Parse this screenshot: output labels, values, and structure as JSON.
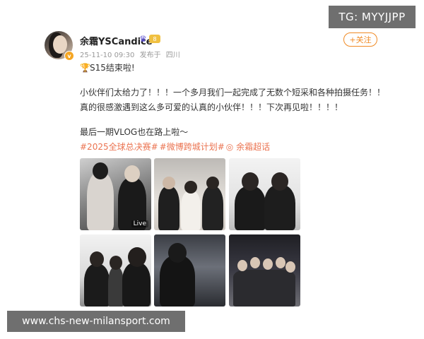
{
  "watermarks": {
    "tg": "TG: MYYJJPP",
    "site": "www.chs-new-milansport.com"
  },
  "post": {
    "author": {
      "name": "余霜YSCandice",
      "level_badge": "8"
    },
    "meta": {
      "timestamp": "25-11-10 09:30",
      "source": "发布于",
      "location": "四川"
    },
    "follow_label": "+关注",
    "lines": {
      "title": "S15结束啦!",
      "p1": "小伙伴们太给力了！！！一个多月我们一起完成了无数个短采和各种拍摄任务！！",
      "p2": "真的很感激遇到这么多可爱的认真的小伙伴！！！下次再见啦！！！！",
      "p3": "最后一期VLOG也在路上啦～"
    },
    "tags": [
      "#2025全球总决赛#",
      "#微博跨城计划#",
      "◎ 余霜超话"
    ],
    "photos": [
      {
        "label": "photo-1",
        "badge": "Live"
      },
      {
        "label": "photo-2"
      },
      {
        "label": "photo-3"
      },
      {
        "label": "photo-4"
      },
      {
        "label": "photo-5"
      },
      {
        "label": "photo-6"
      }
    ]
  },
  "icons": {
    "trophy": "trophy-icon",
    "crown": "crown-icon",
    "verified": "verified-icon"
  },
  "colors": {
    "accent_orange": "#f08a24",
    "tag_color": "#eb7350",
    "watermark_bg": "#6f6f6f"
  }
}
